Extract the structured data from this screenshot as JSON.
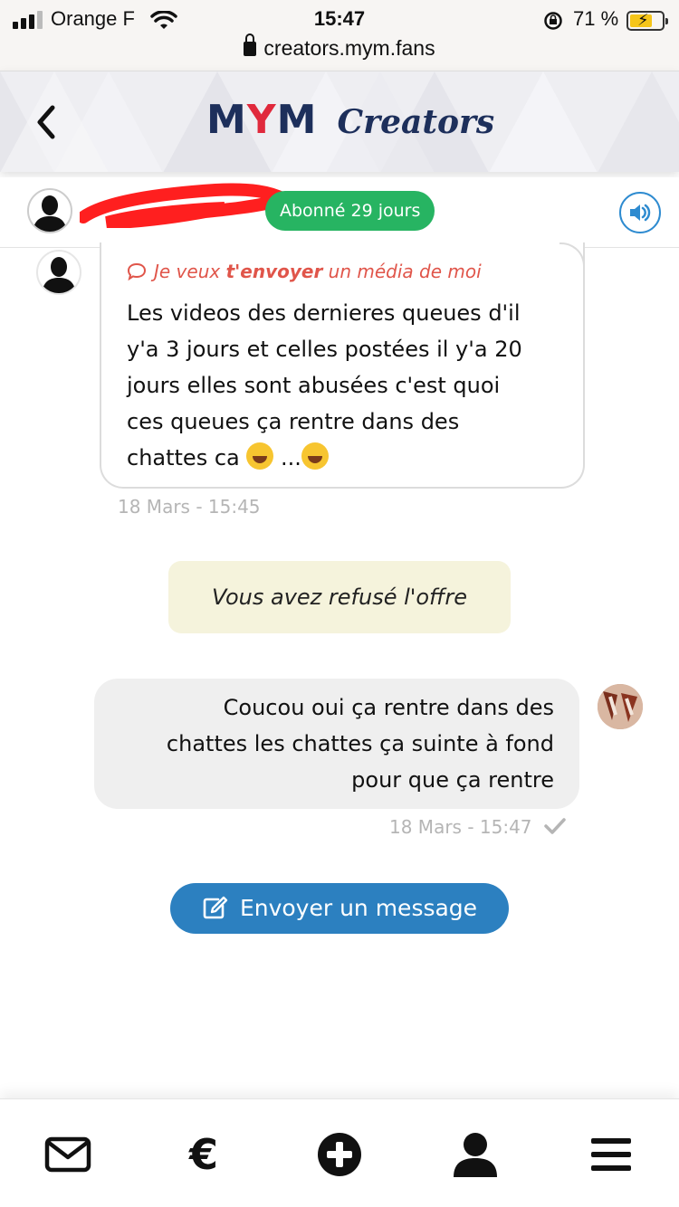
{
  "status_bar": {
    "carrier": "Orange F",
    "time": "15:47",
    "battery_percent": "71 %",
    "battery_level": 0.71,
    "url": "creators.mym.fans"
  },
  "header": {
    "logo_m1": "M",
    "logo_y": "Y",
    "logo_m2": "M",
    "logo_creators": "Creators",
    "back_icon": "chevron-left-icon",
    "brand_colors": {
      "navy": "#1d2f5b",
      "red": "#e0293c"
    }
  },
  "subheader": {
    "subscription_badge": "Abonné 29 jours",
    "badge_color": "#27b462",
    "sound_icon": "volume-icon"
  },
  "messages": {
    "incoming": {
      "request_prefix": "Je veux ",
      "request_bold": "t'envoyer",
      "request_suffix": " un média de moi",
      "line1": "Les videos des dernieres queues d'il",
      "line2": "y'a 3 jours et celles postées il y'a 20",
      "line3": "jours elles sont abusées c'est quoi",
      "line4": "ces queues ça rentre dans des",
      "line5_text": "chattes ca ",
      "line5_mid": " ...",
      "timestamp": "18 Mars - 15:45"
    },
    "system": {
      "refused": "Vous avez refusé l'offre"
    },
    "outgoing": {
      "line1": "Coucou oui ça rentre dans des",
      "line2": "chattes les chattes ça suinte à fond",
      "line3": "pour que ça rentre",
      "timestamp": "18 Mars - 15:47",
      "status_icon": "checkmark-icon"
    }
  },
  "actions": {
    "send_message": "Envoyer un message",
    "send_color": "#2c80c0"
  },
  "bottom_nav": {
    "items": [
      "mail-icon",
      "euro-icon",
      "plus-circle-icon",
      "user-icon",
      "menu-icon"
    ],
    "euro_symbol": "€"
  }
}
